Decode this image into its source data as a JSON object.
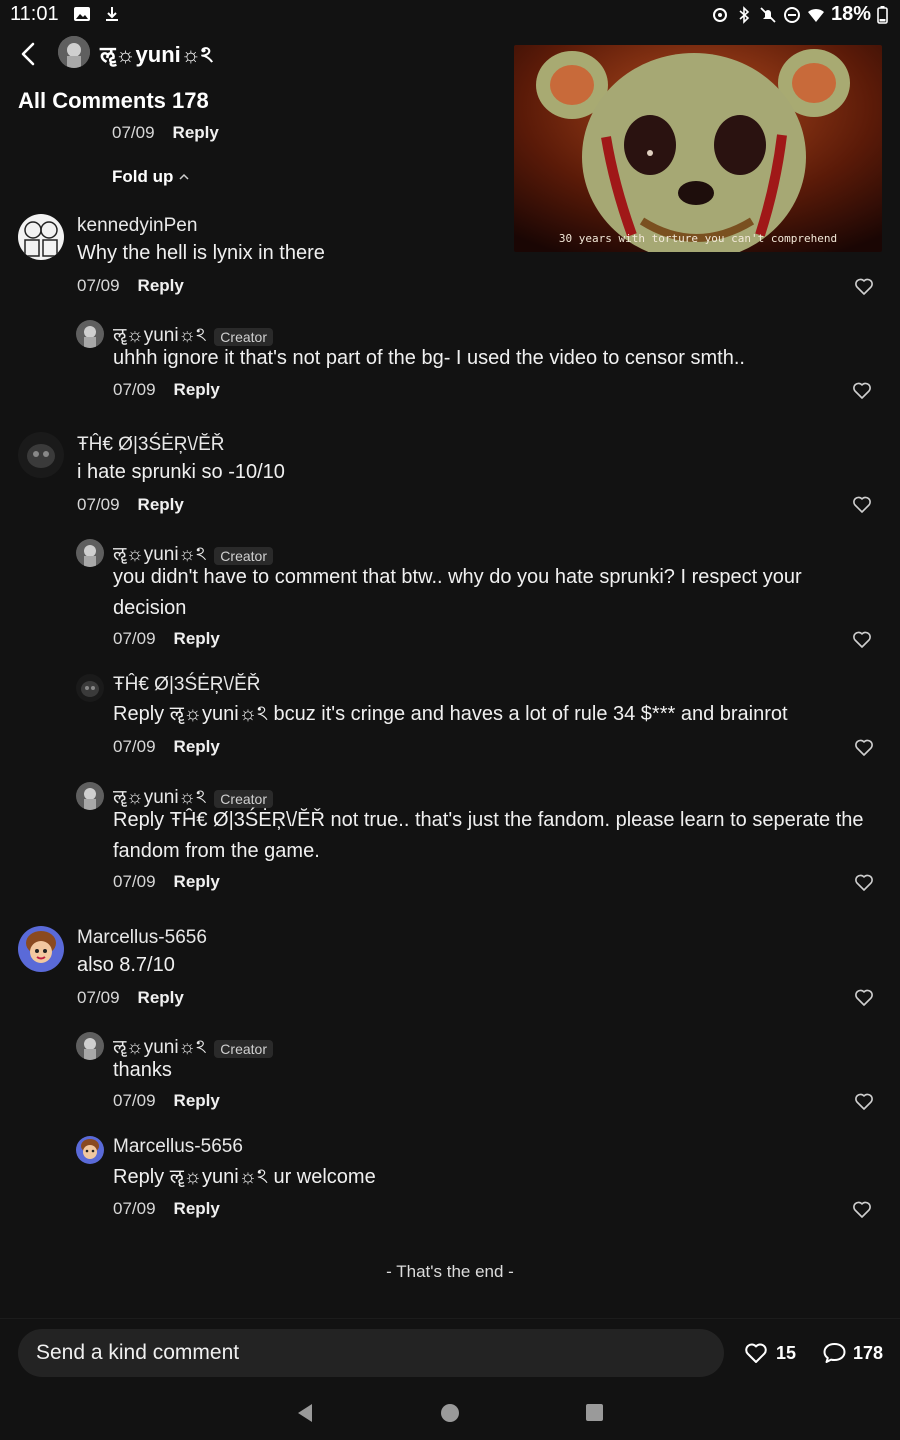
{
  "status_bar": {
    "time": "11:01",
    "battery": "18%"
  },
  "header": {
    "username": "ॡ☼yuni☼ঽ"
  },
  "thumbnail": {
    "caption": "30 years with torture you can't comprehend"
  },
  "section": {
    "title": "All Comments 178"
  },
  "parent_reply": {
    "date": "07/09",
    "reply_label": "Reply"
  },
  "fold": {
    "label": "Fold up"
  },
  "comments": [
    {
      "author": "kennedyinPen",
      "text": "Why the hell is lynix in there",
      "date": "07/09",
      "reply_label": "Reply"
    },
    {
      "author": "ॡ☼yuni☼ঽ",
      "badge": "Creator",
      "text": "uhhh ignore it that's not part of the bg- I used the video to censor smth..",
      "date": "07/09",
      "reply_label": "Reply"
    },
    {
      "author": "ŦĤ€ Ø|3ŚĖŖ\\/ĔŘ",
      "text": "i hate sprunki so -10/10",
      "date": "07/09",
      "reply_label": "Reply"
    },
    {
      "author": "ॡ☼yuni☼ঽ",
      "badge": "Creator",
      "text": "you didn't have to comment that btw.. why do you hate sprunki? I respect your decision",
      "date": "07/09",
      "reply_label": "Reply"
    },
    {
      "author": "ŦĤ€ Ø|3ŚĖŖ\\/ĔŘ",
      "text": "Reply ॡ☼yuni☼ঽ bcuz it's cringe and haves a lot of rule 34 $*** and brainrot",
      "date": "07/09",
      "reply_label": "Reply"
    },
    {
      "author": "ॡ☼yuni☼ঽ",
      "badge": "Creator",
      "text": "Reply ŦĤ€ Ø|3ŚĖŖ\\/ĔŘ not true.. that's just the fandom. please learn to seperate the fandom from the game.",
      "date": "07/09",
      "reply_label": "Reply"
    },
    {
      "author": "Marcellus-5656",
      "text": "also 8.7/10",
      "date": "07/09",
      "reply_label": "Reply"
    },
    {
      "author": "ॡ☼yuni☼ঽ",
      "badge": "Creator",
      "text": "thanks",
      "date": "07/09",
      "reply_label": "Reply"
    },
    {
      "author": "Marcellus-5656",
      "text": "Reply ॡ☼yuni☼ঽ ur welcome",
      "date": "07/09",
      "reply_label": "Reply"
    }
  ],
  "end_text": "- That's the end -",
  "bottom_bar": {
    "placeholder": "Send a kind comment",
    "likes": "15",
    "comments": "178"
  },
  "icons": {
    "back": "chevron-left-icon",
    "like": "heart-outline-icon",
    "comment": "speech-bubble-icon",
    "fold": "chevron-up-icon"
  },
  "colors": {
    "background": "#121212",
    "input": "#232323",
    "badge": "#2a2a2a"
  }
}
